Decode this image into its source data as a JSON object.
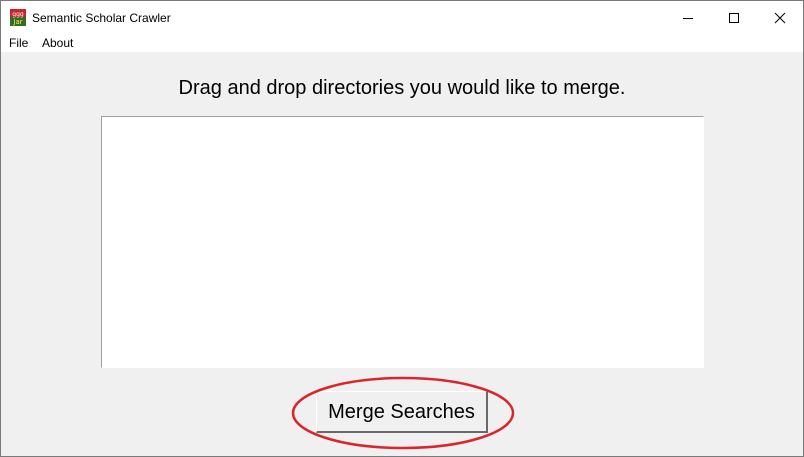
{
  "window": {
    "title": "Semantic Scholar Crawler",
    "icon": "java-app-icon"
  },
  "menu": {
    "items": [
      {
        "label": "File"
      },
      {
        "label": "About"
      }
    ]
  },
  "main": {
    "instruction": "Drag and drop directories you would like to merge.",
    "drop_area": {
      "items": []
    },
    "merge_button_label": "Merge Searches"
  },
  "annotation": {
    "type": "ellipse-highlight",
    "target": "merge-searches-button",
    "color": "#d9262b"
  },
  "colors": {
    "window_bg": "#f0f0f0",
    "titlebar_bg": "#ffffff"
  }
}
